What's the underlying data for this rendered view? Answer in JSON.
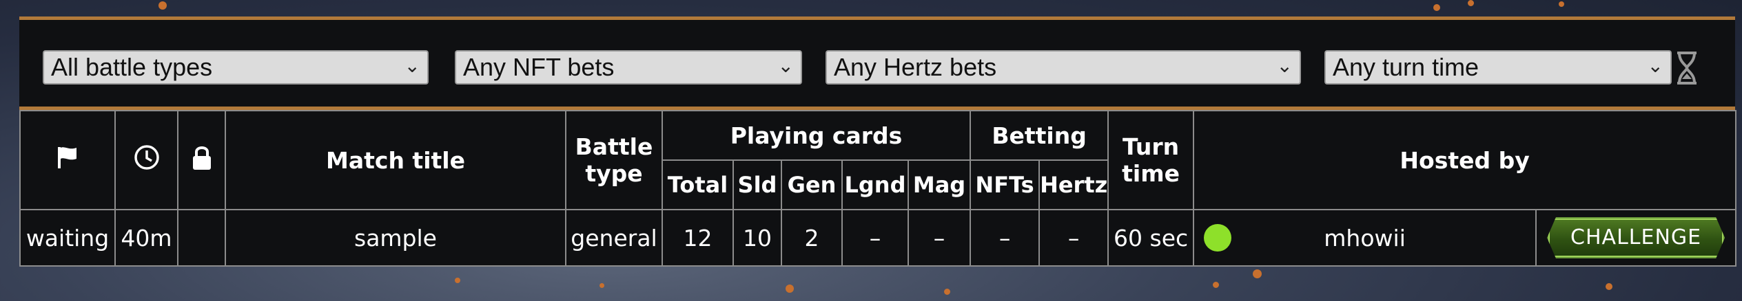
{
  "filters": {
    "battle_type": "All battle types",
    "nft_bets": "Any NFT bets",
    "hertz_bets": "Any Hertz bets",
    "turn_time": "Any turn time"
  },
  "icons": {
    "status": "flag-icon",
    "time": "clock-icon",
    "lock": "lock-icon",
    "filter_timer": "hourglass-icon"
  },
  "table": {
    "headers": {
      "match_title": "Match title",
      "battle_type_line1": "Battle",
      "battle_type_line2": "type",
      "playing_cards": "Playing cards",
      "betting": "Betting",
      "turn_time_line1": "Turn",
      "turn_time_line2": "time",
      "hosted_by": "Hosted by",
      "total": "Total",
      "sld": "Sld",
      "gen": "Gen",
      "lgnd": "Lgnd",
      "mag": "Mag",
      "nfts": "NFTs",
      "hertz": "Hertz"
    },
    "rows": [
      {
        "status": "waiting",
        "age": "40m",
        "title": "sample",
        "battle_type": "general",
        "total": "12",
        "sld": "10",
        "gen": "2",
        "lgnd": "–",
        "mag": "–",
        "nfts": "–",
        "hertz": "–",
        "turn_time": "60 sec",
        "host": "mhowii",
        "action": "CHALLENGE"
      }
    ]
  },
  "colors": {
    "accent_border": "#b27a3a",
    "online_dot": "#8ee02a",
    "challenge_green": "#3a6a18"
  }
}
